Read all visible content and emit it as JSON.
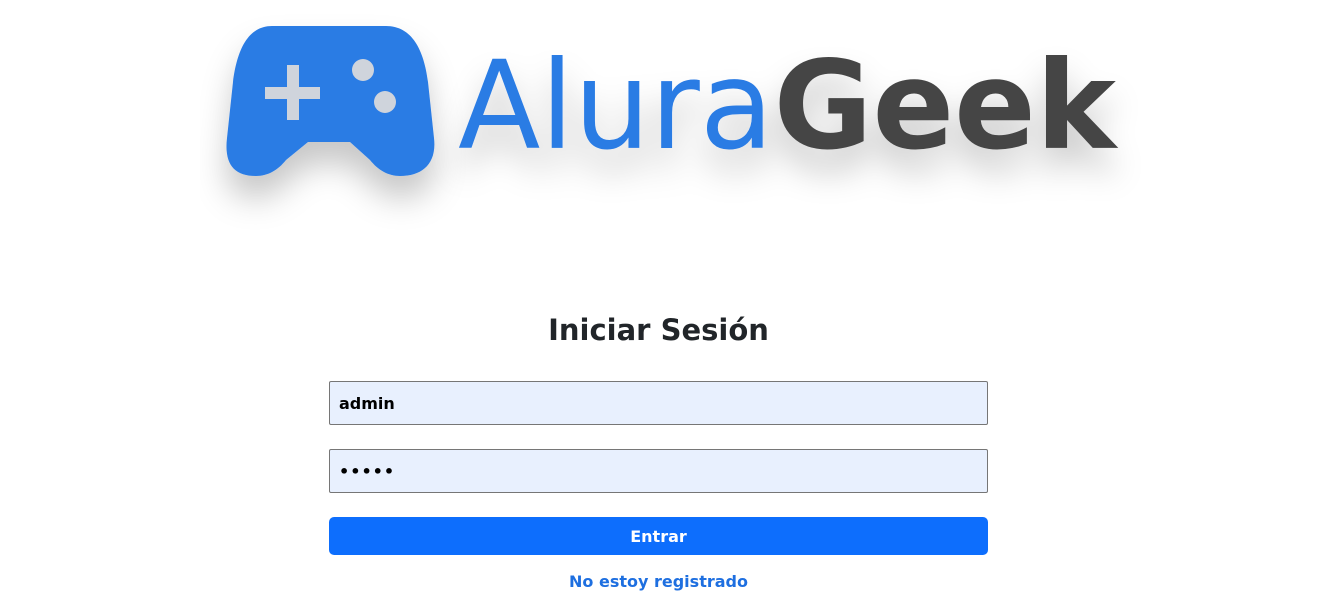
{
  "logo": {
    "brand_first": "Alura",
    "brand_second": "Geek",
    "icon": "gamepad-icon",
    "colors": {
      "primary_blue": "#2b7be4",
      "dark_gray": "#444444",
      "icon_details": "#cfd4dc"
    }
  },
  "login": {
    "title": "Iniciar Sesión",
    "username_value": "admin",
    "password_value": "12345",
    "submit_label": "Entrar",
    "register_link": "No estoy registrado"
  },
  "colors": {
    "input_background": "#e8f0fe",
    "button_background": "#0d6efd",
    "link": "#1e6fe0",
    "title_text": "#212529"
  }
}
